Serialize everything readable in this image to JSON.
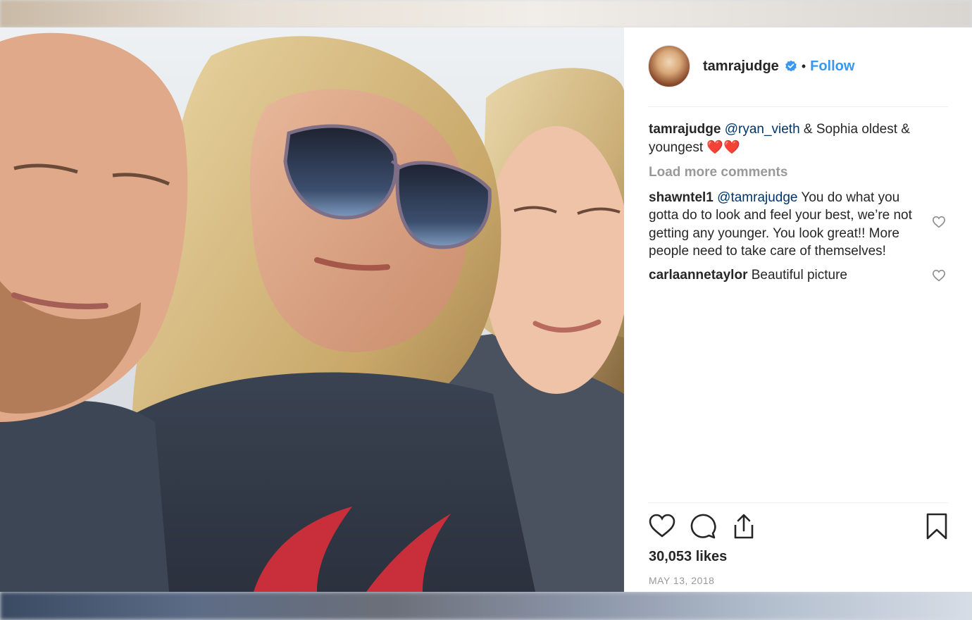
{
  "post": {
    "username": "tamrajudge",
    "follow_label": "Follow",
    "separator": "•",
    "caption": {
      "user": "tamrajudge",
      "mention": "@ryan_vieth",
      "text": " & Sophia oldest & youngest ",
      "emoji": "❤️❤️"
    },
    "load_more_label": "Load more comments",
    "comments": [
      {
        "user": "shawntel1",
        "mention": "@tamrajudge",
        "text": " You do what you gotta do to look and feel your best, we’re not getting any younger. You look great!! More people need to take care of themselves!"
      },
      {
        "user": "carlaannetaylor",
        "mention": "",
        "text": " Beautiful picture"
      }
    ],
    "likes_label": "30,053 likes",
    "date_label": "MAY 13, 2018"
  },
  "icons": {
    "verified": "verified-badge-icon",
    "like": "heart-icon",
    "comment": "comment-bubble-icon",
    "share": "share-icon",
    "save": "bookmark-icon"
  },
  "colors": {
    "link": "#3897f0",
    "mention": "#003569",
    "muted": "#999999",
    "text": "#262626"
  }
}
